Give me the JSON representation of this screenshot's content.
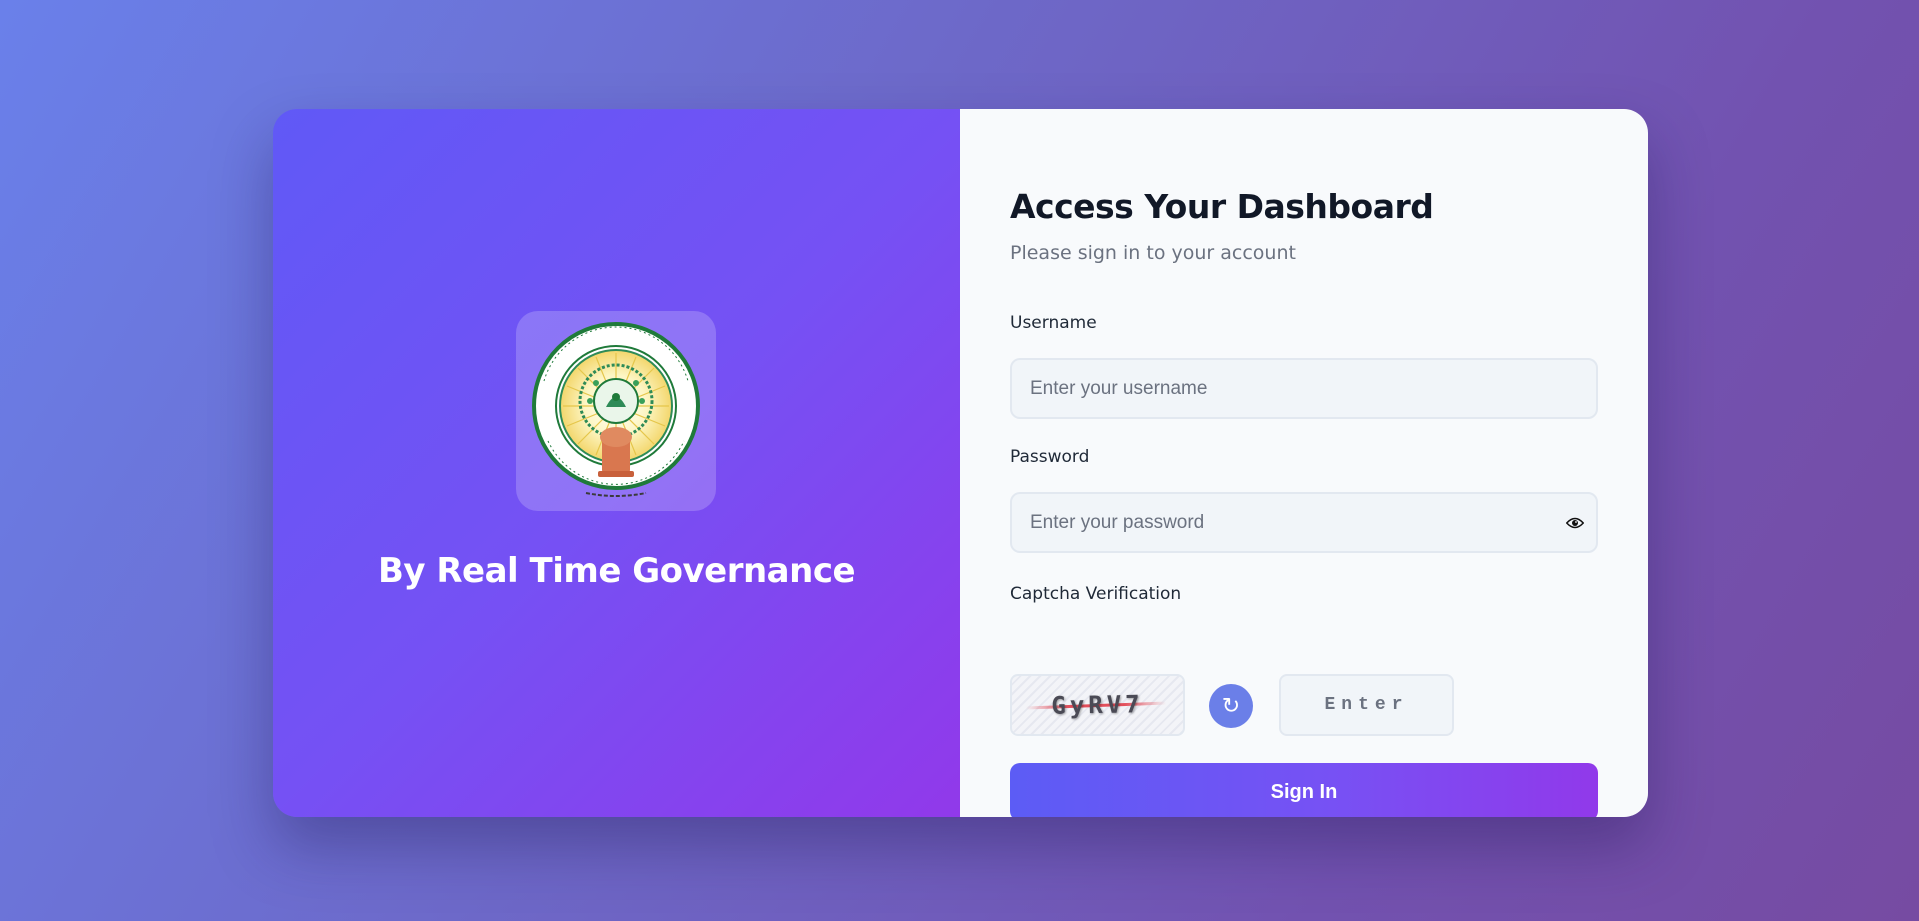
{
  "branding": {
    "logo_icon": "andhra-pradesh-state-emblem",
    "title": "By Real Time Governance"
  },
  "form": {
    "title": "Access Your Dashboard",
    "subtitle": "Please sign in to your account",
    "username": {
      "label": "Username",
      "placeholder": "Enter your username",
      "value": ""
    },
    "password": {
      "label": "Password",
      "placeholder": "Enter your password",
      "value": "",
      "toggle_icon": "eye-icon"
    },
    "captcha": {
      "label": "Captcha Verification",
      "code": "GyRV7",
      "refresh_icon": "↻",
      "input_placeholder": "Enter",
      "input_value": ""
    },
    "submit_label": "Sign In"
  },
  "colors": {
    "accent": "#6366f1",
    "accent_end": "#9333ea",
    "refresh_button": "#6b7fe8",
    "captcha_strike": "#e34f5b"
  }
}
